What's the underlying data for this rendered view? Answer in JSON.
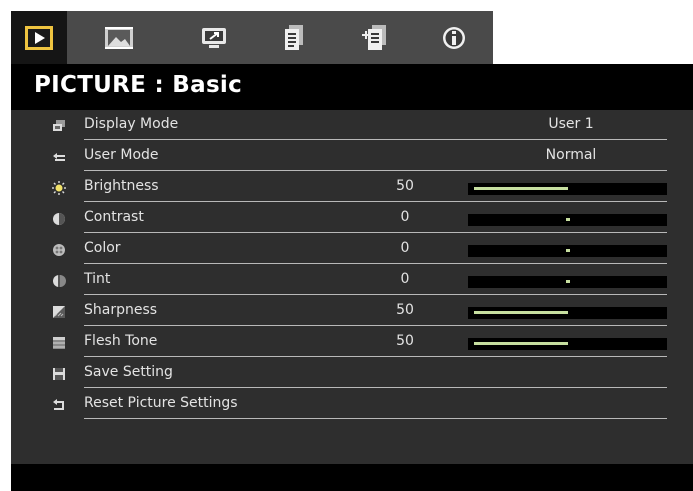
{
  "tabs": [
    {
      "name": "picture",
      "icon": "play-screen-icon",
      "active": true
    },
    {
      "name": "image",
      "icon": "image-frame-icon",
      "active": false
    },
    {
      "name": "display",
      "icon": "monitor-icon",
      "active": false
    },
    {
      "name": "setup",
      "icon": "document-icon",
      "active": false
    },
    {
      "name": "advanced-setup",
      "icon": "documents-plus-icon",
      "active": false
    },
    {
      "name": "information",
      "icon": "info-icon",
      "active": false
    }
  ],
  "page": {
    "title": "PICTURE : Basic"
  },
  "colors": {
    "accent": "#c7dfa0",
    "background": "#2e2e2e",
    "text": "#e3e3e3"
  },
  "menu": {
    "items": [
      {
        "label": "Display Mode",
        "icon": "display-mode-icon",
        "value_text": "User 1"
      },
      {
        "label": "User Mode",
        "icon": "user-mode-icon",
        "value_text": "Normal"
      },
      {
        "label": "Brightness",
        "icon": "brightness-icon",
        "value": "50",
        "slider_level": 0.5
      },
      {
        "label": "Contrast",
        "icon": "contrast-icon",
        "value": "0",
        "slider_level": 0.5
      },
      {
        "label": "Color",
        "icon": "color-icon",
        "value": "0",
        "slider_level": 0.5
      },
      {
        "label": "Tint",
        "icon": "tint-icon",
        "value": "0",
        "slider_level": 0.5
      },
      {
        "label": "Sharpness",
        "icon": "sharpness-icon",
        "value": "50",
        "slider_level": 0.5
      },
      {
        "label": "Flesh Tone",
        "icon": "flesh-tone-icon",
        "value": "50",
        "slider_level": 0.5
      },
      {
        "label": "Save Setting",
        "icon": "save-icon"
      },
      {
        "label": "Reset Picture Settings",
        "icon": "reset-icon"
      }
    ]
  }
}
